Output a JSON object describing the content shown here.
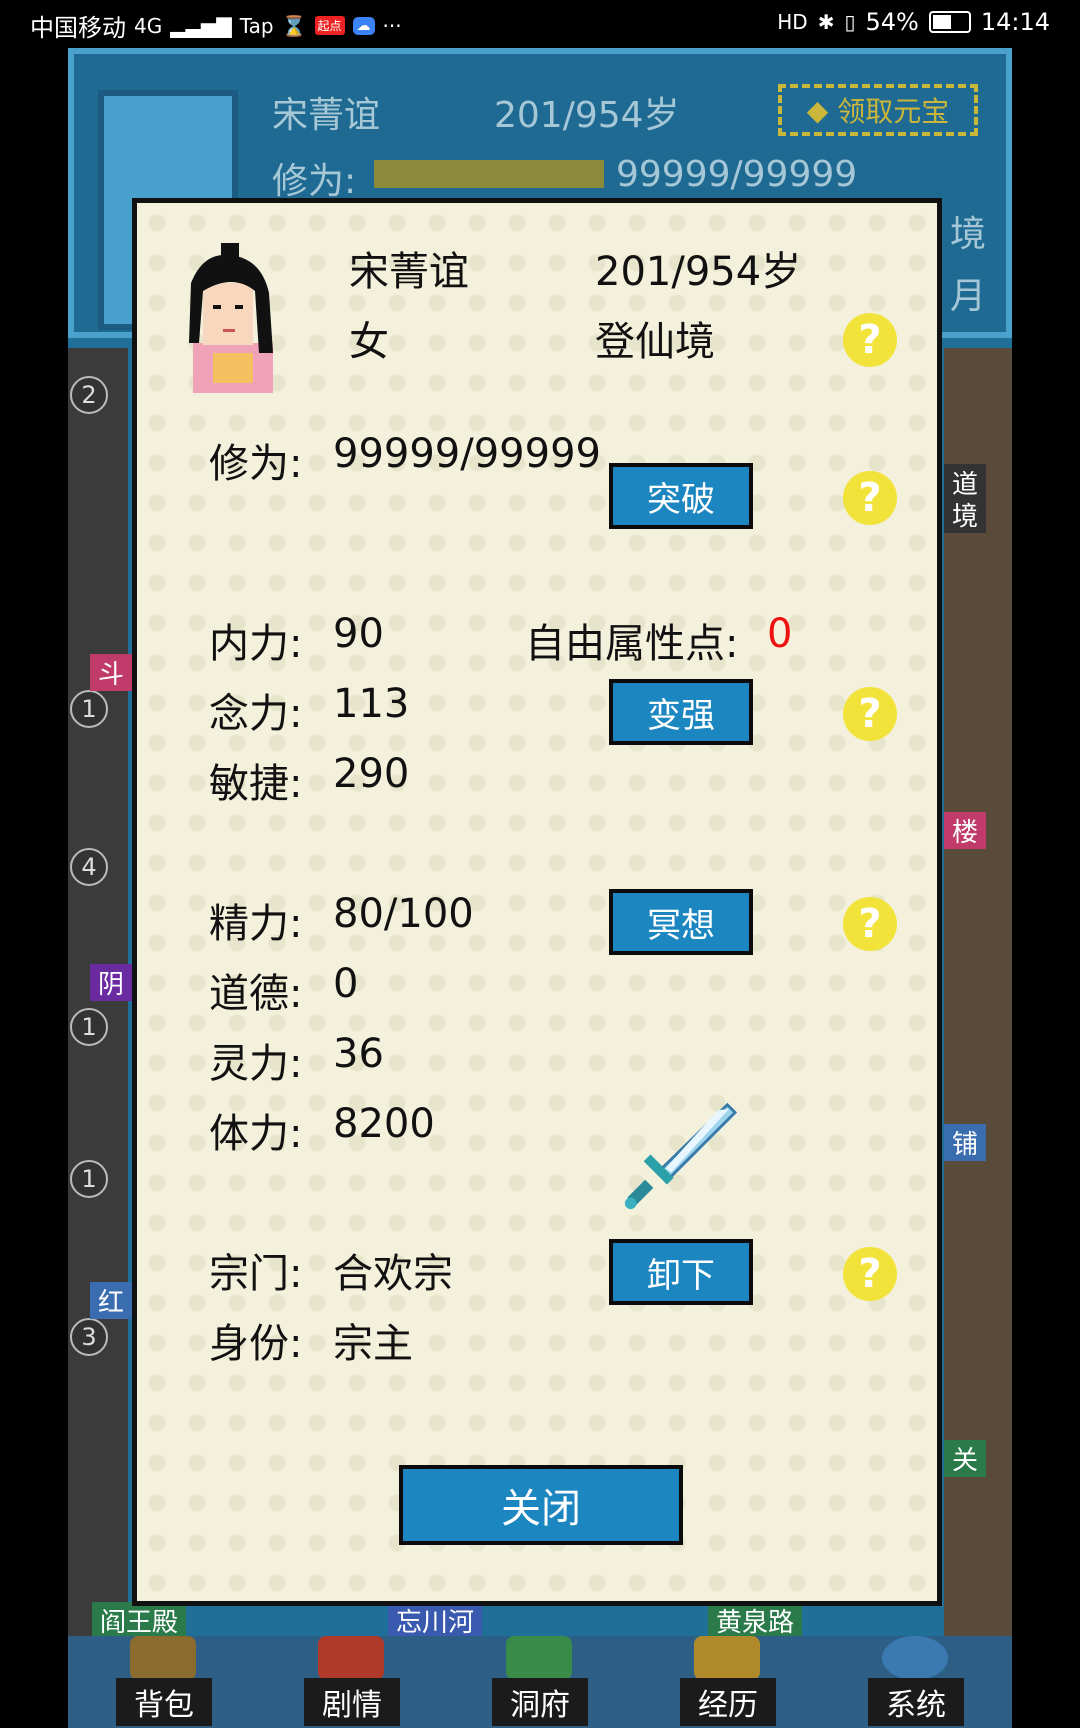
{
  "status_bar": {
    "carrier": "中国移动",
    "network": "4G",
    "battery": "54%",
    "time": "14:14"
  },
  "background": {
    "name": "宋菁谊",
    "age": "201/954岁",
    "cultivation_label": "修为:",
    "cultivation_value": "99999/99999",
    "claim_button": "领取元宝",
    "realm_fragment_1": "境",
    "realm_fragment_2": "月",
    "badge_numbers": [
      "2",
      "1",
      "4",
      "1",
      "1",
      "3"
    ],
    "place_fragments": [
      "斗",
      "阴",
      "红",
      "楼",
      "铺",
      "关",
      "道",
      "境"
    ],
    "bottom_places": [
      "阎王殿",
      "忘川河",
      "黄泉路"
    ]
  },
  "bottom_nav": [
    {
      "label": "背包",
      "icon": "backpack-icon"
    },
    {
      "label": "剧情",
      "icon": "story-icon"
    },
    {
      "label": "洞府",
      "icon": "cave-house-icon"
    },
    {
      "label": "经历",
      "icon": "history-icon"
    },
    {
      "label": "系统",
      "icon": "gear-icon"
    }
  ],
  "dialog": {
    "name": "宋菁谊",
    "age": "201/954岁",
    "gender": "女",
    "realm": "登仙境",
    "cultivation_label": "修为:",
    "cultivation_value": "99999/99999",
    "breakthrough_button": "突破",
    "inner_power_label": "内力:",
    "inner_power_value": "90",
    "free_points_label": "自由属性点:",
    "free_points_value": "0",
    "mind_label": "念力:",
    "mind_value": "113",
    "strengthen_button": "变强",
    "agility_label": "敏捷:",
    "agility_value": "290",
    "energy_label": "精力:",
    "energy_value": "80/100",
    "meditate_button": "冥想",
    "morality_label": "道德:",
    "morality_value": "0",
    "spirit_label": "灵力:",
    "spirit_value": "36",
    "stamina_label": "体力:",
    "stamina_value": "8200",
    "sect_label": "宗门:",
    "sect_value": "合欢宗",
    "unequip_button": "卸下",
    "identity_label": "身份:",
    "identity_value": "宗主",
    "close_button": "关闭",
    "help_symbol": "?"
  },
  "colors": {
    "dialog_bg": "#f3f1dc",
    "button_blue": "#1c86c0",
    "help_yellow": "#f2e33a",
    "free_points_red": "#e11111"
  }
}
